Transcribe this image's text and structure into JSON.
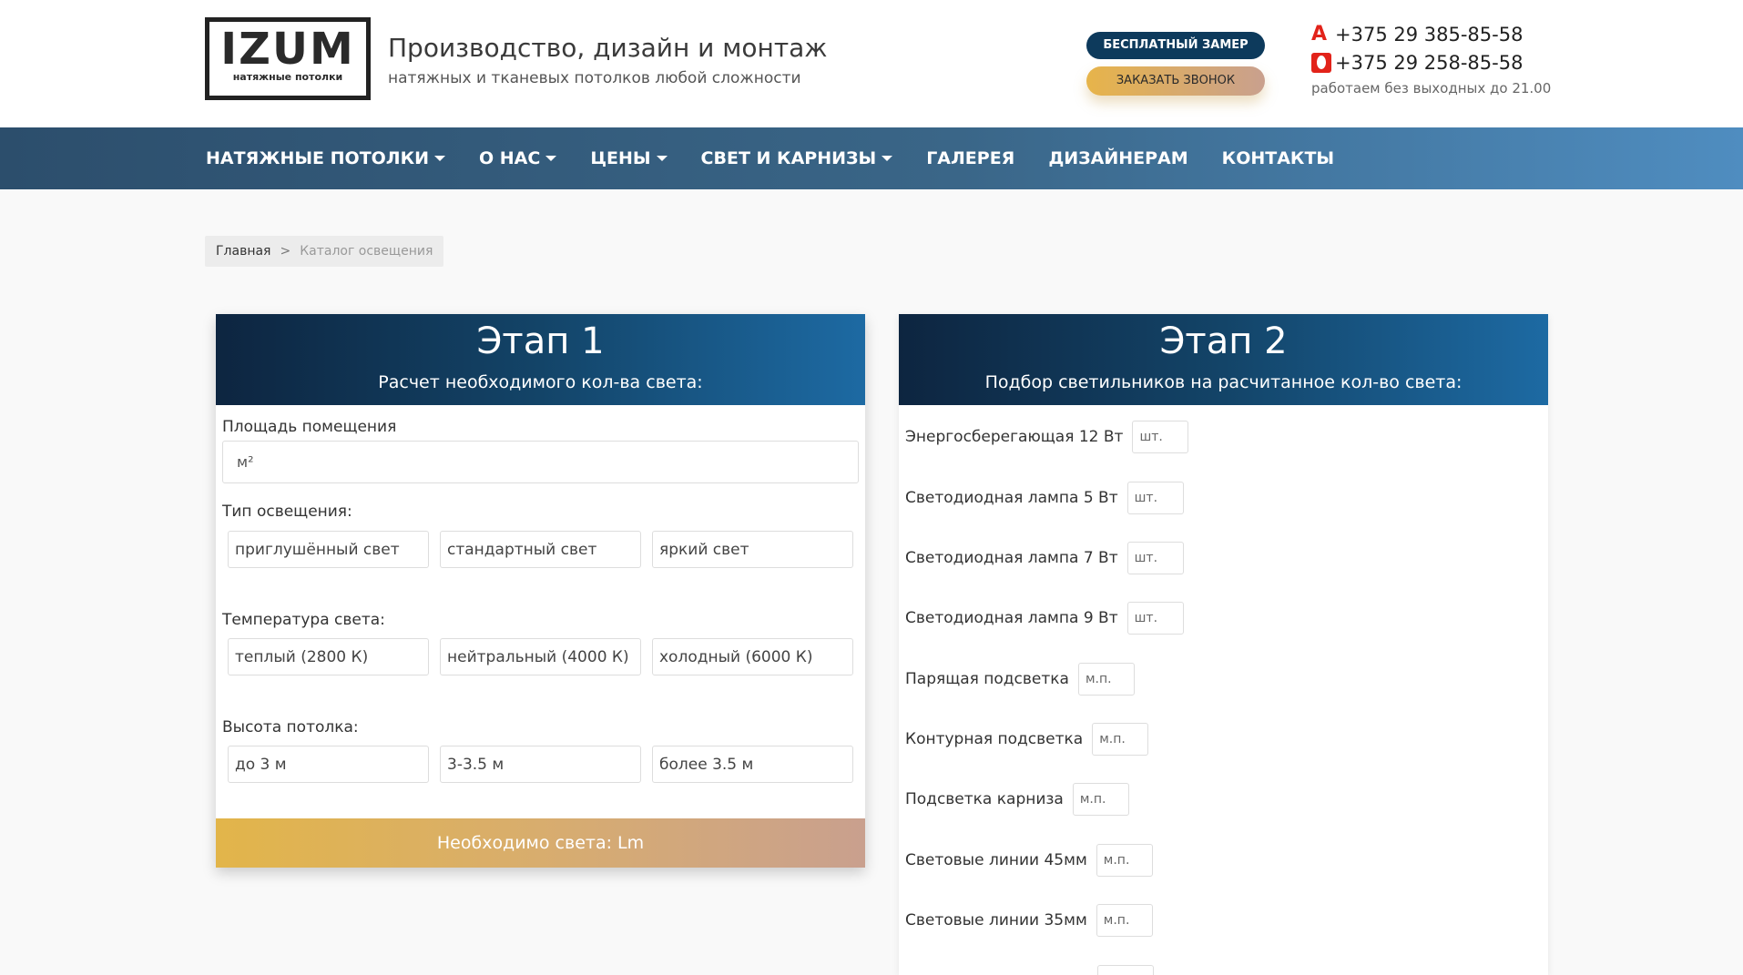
{
  "header": {
    "logo_text": "IZUM",
    "logo_sub": "натяжные потолки",
    "tagline_main": "Производство, дизайн и монтаж",
    "tagline_sub": "натяжных и тканевых потолков любой сложности",
    "btn_measure": "БЕСПЛАТНЫЙ ЗАМЕР",
    "btn_call": "ЗАКАЗАТЬ ЗВОНОК",
    "phone1": "+375 29 385-85-58",
    "phone2": "+375 29 258-85-58",
    "work_hours": "работаем без выходных до 21.00",
    "icons": [
      "a1-icon",
      "mts-icon"
    ]
  },
  "nav": {
    "items": [
      {
        "label": "НАТЯЖНЫЕ ПОТОЛКИ",
        "dropdown": true
      },
      {
        "label": "О НАС",
        "dropdown": true
      },
      {
        "label": "ЦЕНЫ",
        "dropdown": true
      },
      {
        "label": "СВЕТ И КАРНИЗЫ",
        "dropdown": true
      },
      {
        "label": "ГАЛЕРЕЯ",
        "dropdown": false
      },
      {
        "label": "ДИЗАЙНЕРАМ",
        "dropdown": false
      },
      {
        "label": "КОНТАКТЫ",
        "dropdown": false
      }
    ]
  },
  "breadcrumb": {
    "home": "Главная",
    "separator": ">",
    "current": "Каталог освещения"
  },
  "stage1": {
    "title": "Этап 1",
    "subtitle": "Расчет необходимого кол-ва света:",
    "area_label": "Площадь помещения",
    "area_placeholder": "м²",
    "light_type_label": "Тип освещения:",
    "light_types": [
      "приглушённый свет",
      "стандартный свет",
      "яркий свет"
    ],
    "temperature_label": "Температура света:",
    "temperatures": [
      "теплый (2800 К)",
      "нейтральный (4000 К)",
      "холодный (6000 К)"
    ],
    "height_label": "Высота потолка:",
    "heights": [
      "до 3 м",
      "3-3.5 м",
      "более 3.5 м"
    ],
    "result": "Необходимо света: Lm"
  },
  "stage2": {
    "title": "Этап 2",
    "subtitle": "Подбор светильников на расчитанное кол-во света:",
    "items": [
      {
        "label": "Энергосберегающая 12 Вт",
        "unit": "шт."
      },
      {
        "label": "Светодиодная лампа 5 Вт",
        "unit": "шт."
      },
      {
        "label": "Светодиодная лампа 7 Вт",
        "unit": "шт."
      },
      {
        "label": "Светодиодная лампа 9 Вт",
        "unit": "шт."
      },
      {
        "label": "Парящая подсветка",
        "unit": "м.п."
      },
      {
        "label": "Контурная подсветка",
        "unit": "м.п."
      },
      {
        "label": "Подсветка карниза",
        "unit": "м.п."
      },
      {
        "label": "Световые линии 45мм",
        "unit": "м.п."
      },
      {
        "label": "Световые линии 35мм",
        "unit": "м.п."
      }
    ]
  },
  "colors": {
    "nav_gradient_start": "#2c4e6c",
    "nav_gradient_end": "#4f8dc0",
    "panel_head_start": "#0d2540",
    "panel_head_end": "#1d6aa3",
    "accent_gold": "#e2b54a",
    "btn_dark": "#0d3a5c"
  }
}
